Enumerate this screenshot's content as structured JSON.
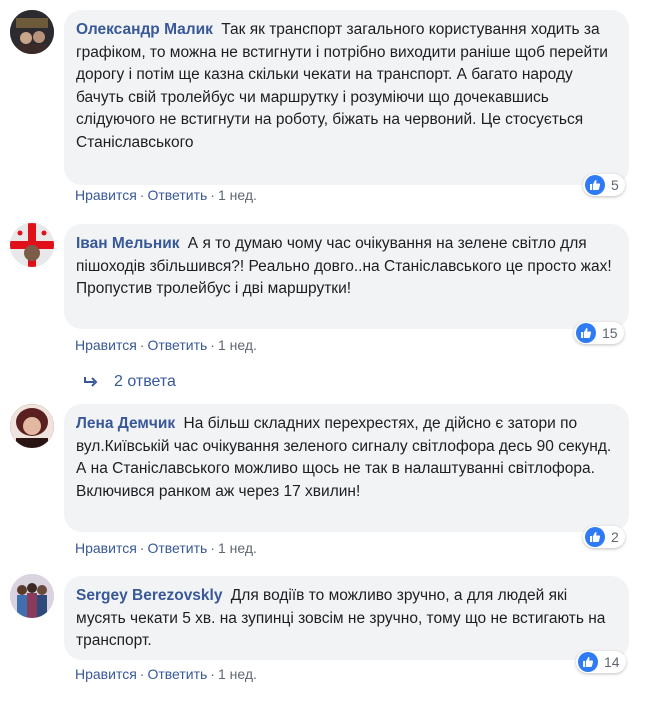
{
  "comments": [
    {
      "author": "Олександр Малик",
      "text": "Так як транспорт загального користування ходить за графіком, то можна не встигнути і потрібно виходити раніше щоб перейти дорогу і потім ще казна скільки чекати на транспорт. А багато народу бачуть свій тролейбус чи маршрутку і розуміючи що дочекавшись слідуючого не встигнути на роботу, біжать на червоний. Це стосується Станіславського",
      "likes": "5",
      "like_label": "Нравится",
      "reply_label": "Ответить",
      "time": "1 нед."
    },
    {
      "author": "Іван Мельник",
      "text": "А я то думаю чому час очікування на зелене світло для пішоходів збільшився?! Реально довго..на Станіславського це просто жах! Пропустив тролейбус і дві маршрутки!",
      "likes": "15",
      "like_label": "Нравится",
      "reply_label": "Ответить",
      "time": "1 нед.",
      "replies_label": "2 ответа"
    },
    {
      "author": "Лена Демчик",
      "text": "На більш складних перехрестях, де дійсно є затори по вул.Київській час очікування зеленого сигналу світлофора десь 90 секунд. А на Станіславського можливо щось не так в налаштуванні світлофора. Включився ранком аж через 17 хвилин!",
      "likes": "2",
      "like_label": "Нравится",
      "reply_label": "Ответить",
      "time": "1 нед."
    },
    {
      "author": "Sergey Berezovskly",
      "text": "Для водіїв то можливо зручно, а для людей які мусять чекати 5 хв. на зупинці зовсім не зручно, тому що не встигають на транспорт.",
      "likes": "14",
      "like_label": "Нравится",
      "reply_label": "Ответить",
      "time": "1 нед."
    }
  ],
  "colors": {
    "link": "#385898",
    "bubble": "#f2f3f5",
    "like": "#2f7bf5",
    "meta": "#606770"
  }
}
